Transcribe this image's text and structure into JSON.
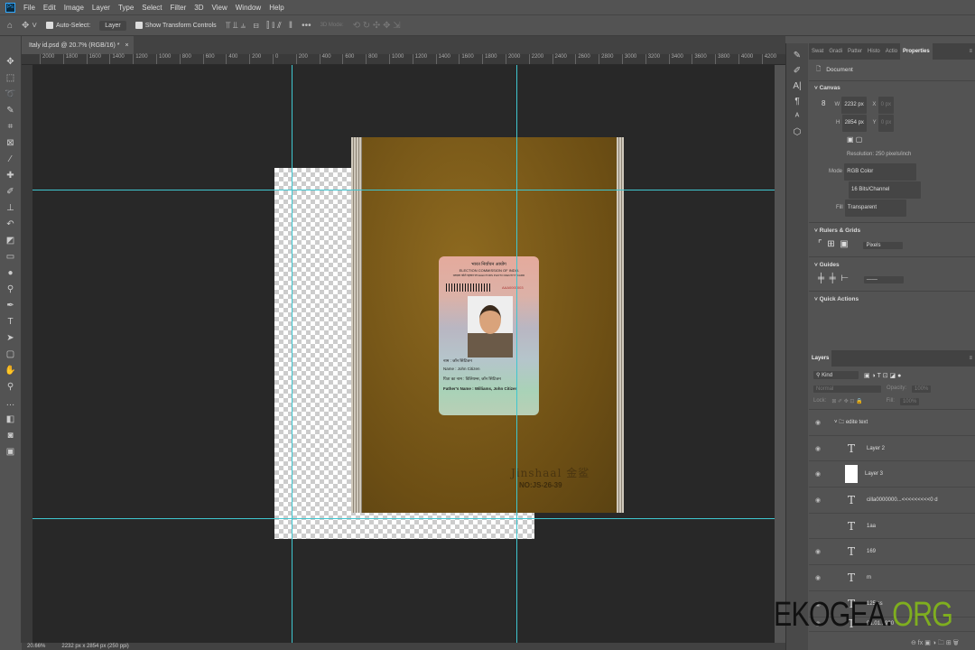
{
  "menu": [
    "File",
    "Edit",
    "Image",
    "Layer",
    "Type",
    "Select",
    "Filter",
    "3D",
    "View",
    "Window",
    "Help"
  ],
  "options": {
    "auto_select": "Auto-Select:",
    "auto_select_target": "Layer",
    "show_transform": "Show Transform Controls",
    "mode_3d": "3D Mode:"
  },
  "document_tab": {
    "title": "Italy id.psd @ 20.7% (RGB/16) *",
    "close": "×"
  },
  "ruler_top": [
    "2000",
    "1800",
    "1600",
    "1400",
    "1200",
    "1000",
    "800",
    "600",
    "400",
    "200",
    "0",
    "200",
    "400",
    "600",
    "800",
    "1000",
    "1200",
    "1400",
    "1600",
    "1800",
    "2000",
    "2200",
    "2400",
    "2600",
    "2800",
    "3000",
    "3200",
    "3400",
    "3600",
    "3800",
    "4000",
    "4200"
  ],
  "card": {
    "header_hi": "भारत निर्वाचन आयोग",
    "header_en": "ELECTION COMMISSION OF INDIA",
    "subheader": "मतदाता फोटो पहचान पत्र  ELECTORS PHOTO IDENTITY CARD",
    "epic": "AAA0000003",
    "name_hi": "नाम : जॉन सिटिजन",
    "name_en": "Name : John Citizen",
    "father_hi": "पिता का नाम : विलियम्स, जॉन सिटिजन",
    "father_en": "Father's Name : Williams, John Citizen"
  },
  "cover": {
    "brand": "Jinshaal 金鲨",
    "number": "NO:JS-26-39"
  },
  "status": {
    "zoom": "20.66%",
    "dimensions": "2232 px x 2854 px (250 ppi)"
  },
  "properties": {
    "tabs": [
      "Swat",
      "Gradi",
      "Patter",
      "Histo",
      "Actio",
      "Properties"
    ],
    "active_tab": "Properties",
    "kind": "Document",
    "canvas_title": "Canvas",
    "w_label": "W",
    "w": "2232 px",
    "h_label": "H",
    "h": "2854 px",
    "x_label": "X",
    "x": "0 px",
    "y_label": "Y",
    "y": "0 px",
    "resolution": "Resolution: 250 pixels/inch",
    "mode_label": "Mode",
    "mode": "RGB Color",
    "depth": "16 Bits/Channel",
    "fill_label": "Fill",
    "fill": "Transparent",
    "rulers_title": "Rulers & Grids",
    "units": "Pixels",
    "guides_title": "Guides",
    "quick_actions": "Quick Actions"
  },
  "layers": {
    "title": "Layers",
    "filter": "Kind",
    "blend": "Normal",
    "opacity_label": "Opacity:",
    "opacity": "100%",
    "lock_label": "Lock:",
    "fill_label": "Fill:",
    "fill": "100%",
    "items": [
      {
        "name": "edite text",
        "type": "group"
      },
      {
        "name": "Layer 2",
        "type": "text"
      },
      {
        "name": "Layer 3",
        "type": "pixel"
      },
      {
        "name": "cilla0000000...<<<<<<<<<0 d",
        "type": "text"
      },
      {
        "name": "1aa",
        "type": "text"
      },
      {
        "name": "169",
        "type": "text"
      },
      {
        "name": "m",
        "type": "text"
      },
      {
        "name": "125 ss",
        "type": "text"
      },
      {
        "name": "01.01.1990",
        "type": "text"
      }
    ]
  },
  "watermark": {
    "a": "EKOGEA.",
    "b": "ORG"
  },
  "colors": {
    "guide": "#3fc6d0",
    "canvas_bg": "#282828",
    "panel": "#535353"
  }
}
